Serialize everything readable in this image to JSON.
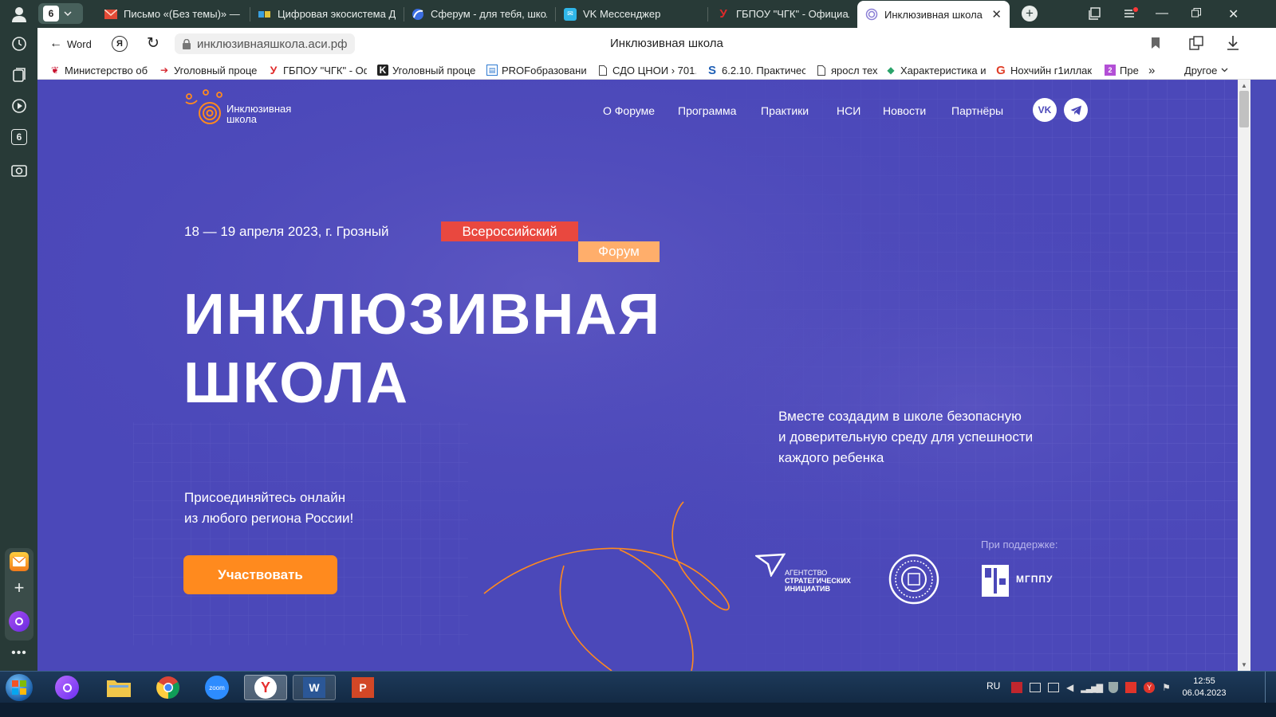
{
  "browser": {
    "tab_counter": "6",
    "tabs": [
      {
        "title": "Письмо «(Без темы)» — N"
      },
      {
        "title": "Цифровая экосистема ДГ"
      },
      {
        "title": "Сферум - для тебя, школ"
      },
      {
        "title": "VK Мессенджер"
      },
      {
        "title": "ГБПОУ \"ЧГК\" - Официаль"
      },
      {
        "title": "Инклюзивная школа"
      }
    ],
    "back_label": "Word",
    "url": "инклюзивнаяшкола.аси.рф",
    "page_title": "Инклюзивная школа",
    "bookmarks": [
      {
        "label": "Министерство об"
      },
      {
        "label": "Уголовный проце"
      },
      {
        "label": "ГБПОУ \"ЧГК\" - Оф"
      },
      {
        "label": "Уголовный проце"
      },
      {
        "label": "PROFобразование"
      },
      {
        "label": "СДО ЦНОИ › 701."
      },
      {
        "label": "6.2.10. Практичес"
      },
      {
        "label": "яросл тех"
      },
      {
        "label": "Характеристика и"
      },
      {
        "label": "Нохчийн г1иллак"
      },
      {
        "label": "Пре"
      }
    ],
    "bookmarks_more": "Другое",
    "sidebar_badge": "6"
  },
  "site": {
    "logo_line1": "Инклюзивная",
    "logo_line2": "школа",
    "nav": [
      "О Форуме",
      "Программа",
      "Практики",
      "НСИ",
      "Новости",
      "Партнёры"
    ],
    "social": {
      "vk": "VK",
      "tg": "telegram"
    },
    "date_location": "18 — 19 апреля 2023, г. Грозный",
    "badge_1": "Всероссийский",
    "badge_2": "Форум",
    "headline_1": "ИНКЛЮЗИВНАЯ",
    "headline_2": "ШКОЛА",
    "join_1": "Присоединяйтесь онлайн",
    "join_2": "из любого региона России!",
    "cta": "Участвовать",
    "tagline_1": "Вместе создадим в школе безопасную",
    "tagline_2": "и доверительную среду для успешности",
    "tagline_3": "каждого ребенка",
    "support_label": "При поддержке:",
    "partner_asi_1": "АГЕНТСТВО",
    "partner_asi_2": "СТРАТЕГИЧЕСКИХ",
    "partner_asi_3": "ИНИЦИАТИВ",
    "partner_mgppu": "МГППУ"
  },
  "taskbar": {
    "lang": "RU",
    "time": "12:55",
    "date": "06.04.2023",
    "zoom_label": "zoom"
  },
  "colors": {
    "page_bg": "#4b48b9",
    "accent_orange": "#ff8a1e",
    "badge_red": "#e9483f",
    "badge_peach": "#ffae6b",
    "browser_dark": "#283a37"
  }
}
